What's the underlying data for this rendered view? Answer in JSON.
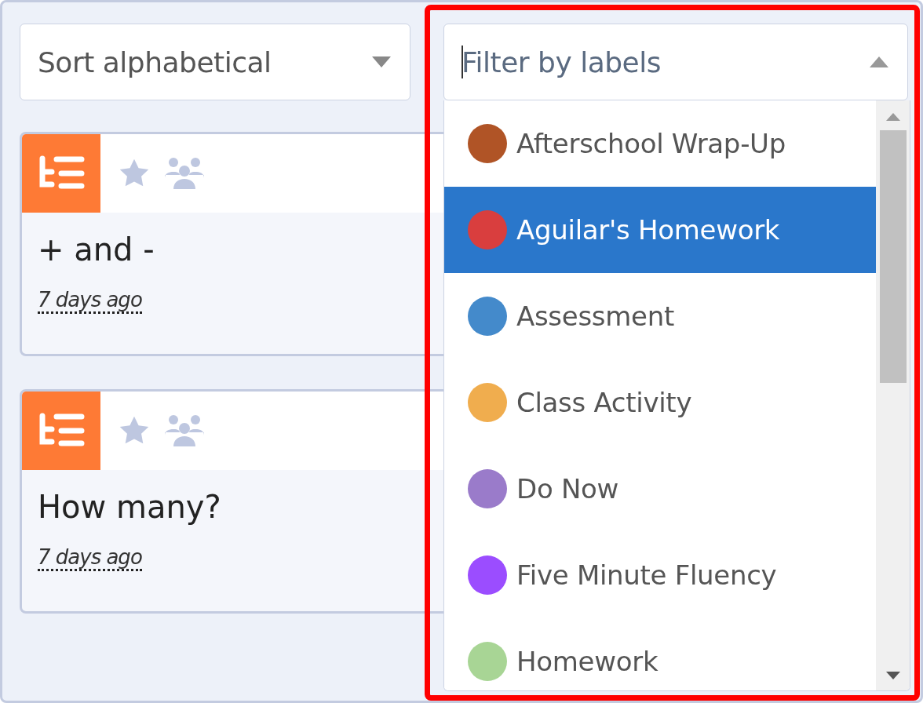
{
  "sort_select": {
    "value": "Sort alphabetical"
  },
  "label_filter": {
    "placeholder": "Filter by labels",
    "expanded": true,
    "options": [
      {
        "name": "Afterschool Wrap-Up",
        "color": "#b05426",
        "selected": false
      },
      {
        "name": "Aguilar's Homework",
        "color": "#d93e3e",
        "selected": true
      },
      {
        "name": "Assessment",
        "color": "#448acb",
        "selected": false
      },
      {
        "name": "Class Activity",
        "color": "#f0ad4e",
        "selected": false
      },
      {
        "name": "Do Now",
        "color": "#9a7bca",
        "selected": false
      },
      {
        "name": "Five Minute Fluency",
        "color": "#9b4dff",
        "selected": false
      },
      {
        "name": "Homework",
        "color": "#a8d595",
        "selected": false
      }
    ]
  },
  "cards": [
    {
      "title": "+ and -",
      "time": "7 days ago"
    },
    {
      "title": "How many?",
      "time": "7 days ago"
    }
  ]
}
